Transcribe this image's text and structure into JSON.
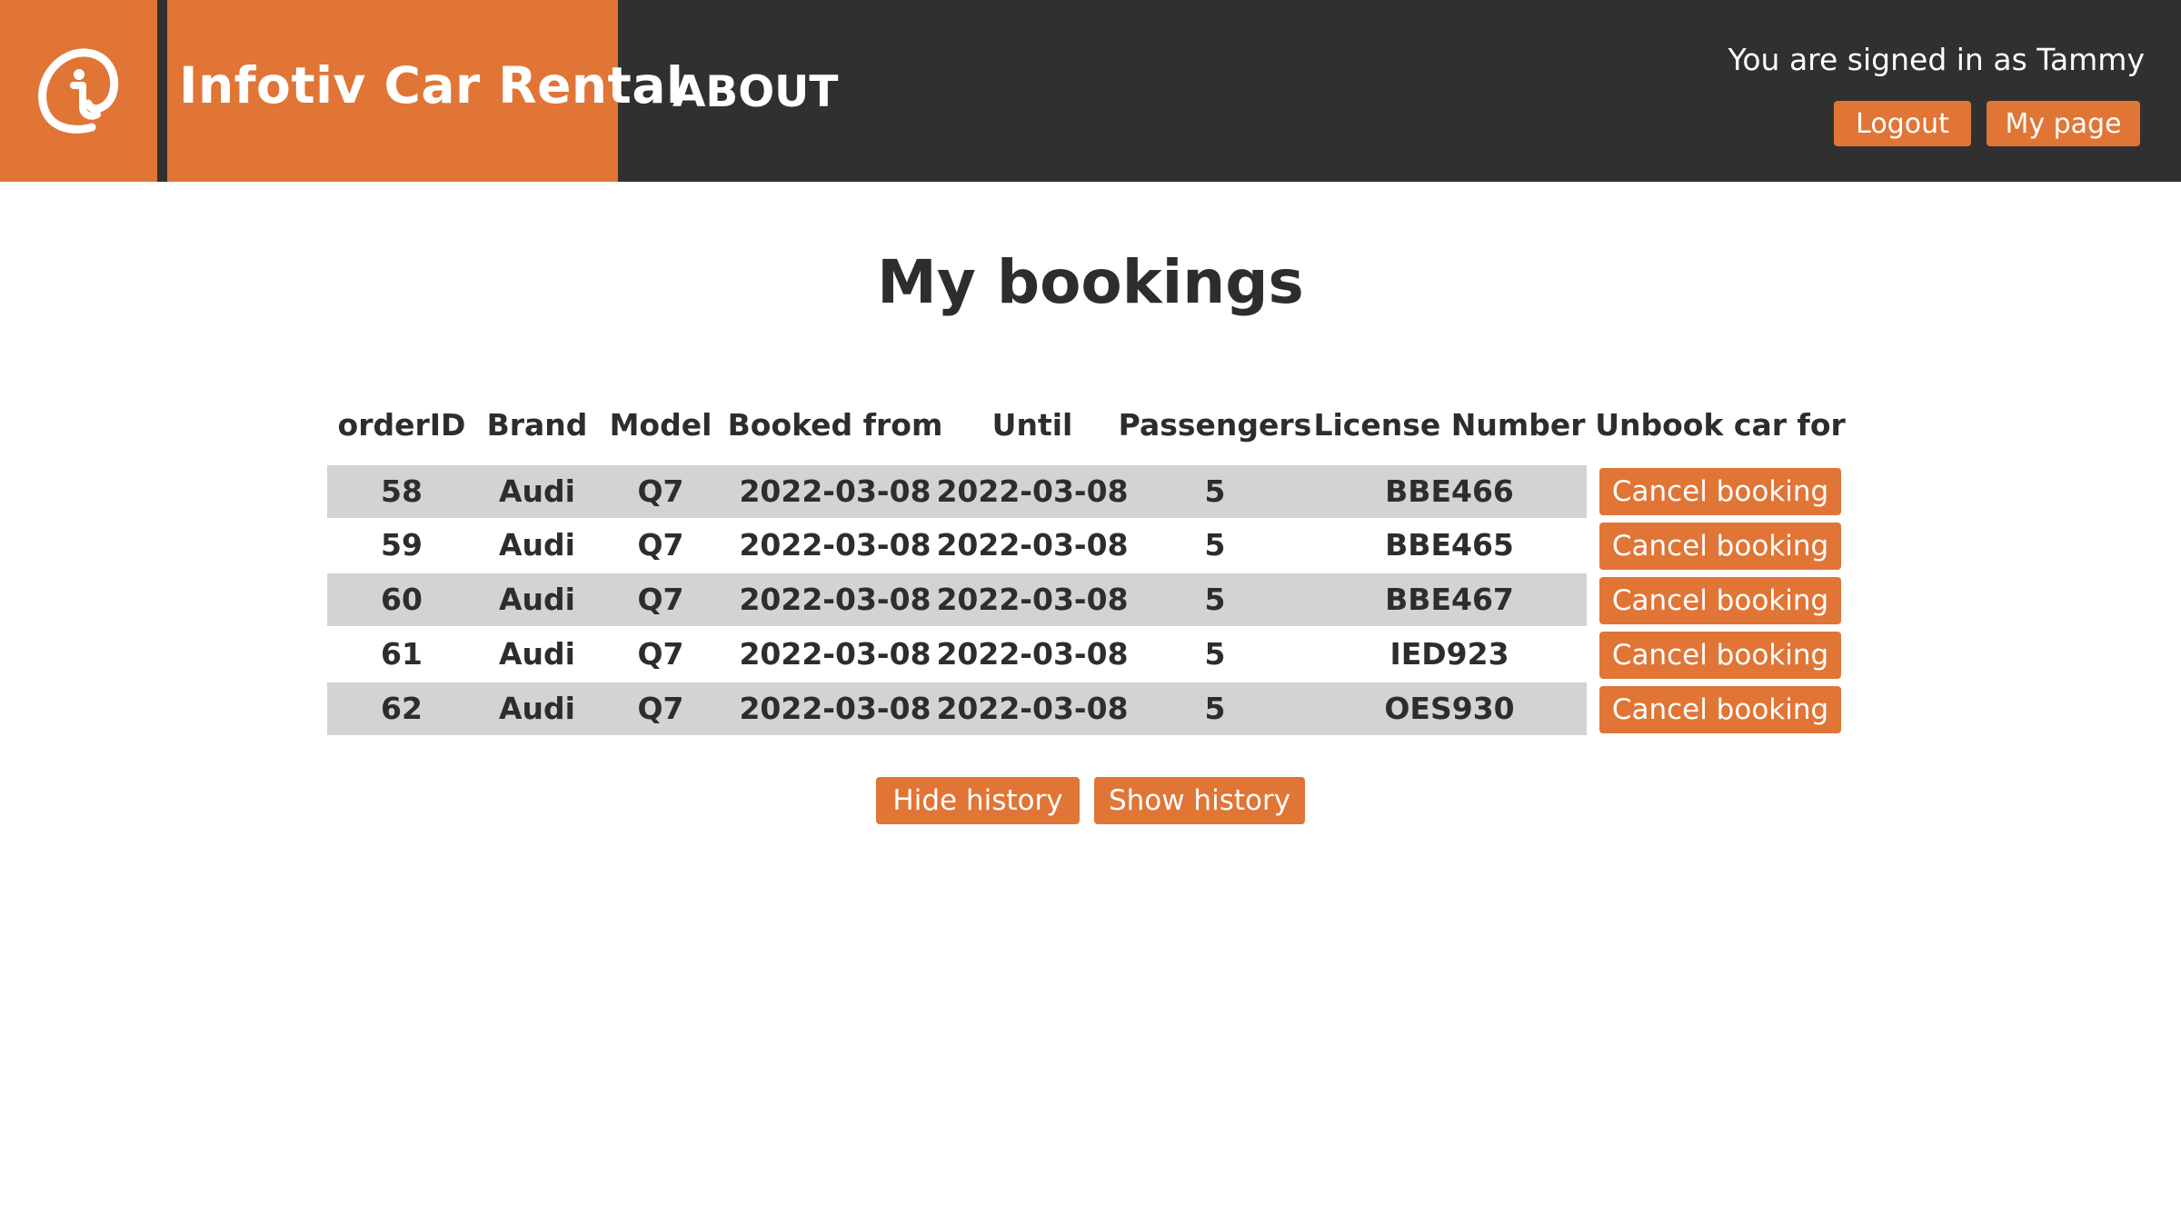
{
  "header": {
    "brand_title": "Infotiv Car Rental",
    "logo_icon": "infotiv-logo-icon",
    "nav_about": "ABOUT",
    "signed_in_text": "You are signed in as Tammy",
    "logout_label": "Logout",
    "mypage_label": "My page"
  },
  "main": {
    "page_title": "My bookings",
    "columns": [
      "orderID",
      "Brand",
      "Model",
      "Booked from",
      "Until",
      "Passengers",
      "License Number",
      "Unbook car for"
    ],
    "rows": [
      {
        "orderID": "58",
        "brand": "Audi",
        "model": "Q7",
        "from": "2022-03-08",
        "until": "2022-03-08",
        "passengers": "5",
        "license": "BBE466",
        "action": "Cancel booking"
      },
      {
        "orderID": "59",
        "brand": "Audi",
        "model": "Q7",
        "from": "2022-03-08",
        "until": "2022-03-08",
        "passengers": "5",
        "license": "BBE465",
        "action": "Cancel booking"
      },
      {
        "orderID": "60",
        "brand": "Audi",
        "model": "Q7",
        "from": "2022-03-08",
        "until": "2022-03-08",
        "passengers": "5",
        "license": "BBE467",
        "action": "Cancel booking"
      },
      {
        "orderID": "61",
        "brand": "Audi",
        "model": "Q7",
        "from": "2022-03-08",
        "until": "2022-03-08",
        "passengers": "5",
        "license": "IED923",
        "action": "Cancel booking"
      },
      {
        "orderID": "62",
        "brand": "Audi",
        "model": "Q7",
        "from": "2022-03-08",
        "until": "2022-03-08",
        "passengers": "5",
        "license": "OES930",
        "action": "Cancel booking"
      }
    ],
    "hide_history_label": "Hide history",
    "show_history_label": "Show history"
  },
  "colors": {
    "accent": "#e07536",
    "header_bg": "#303030",
    "row_shade": "#d3d3d3"
  }
}
